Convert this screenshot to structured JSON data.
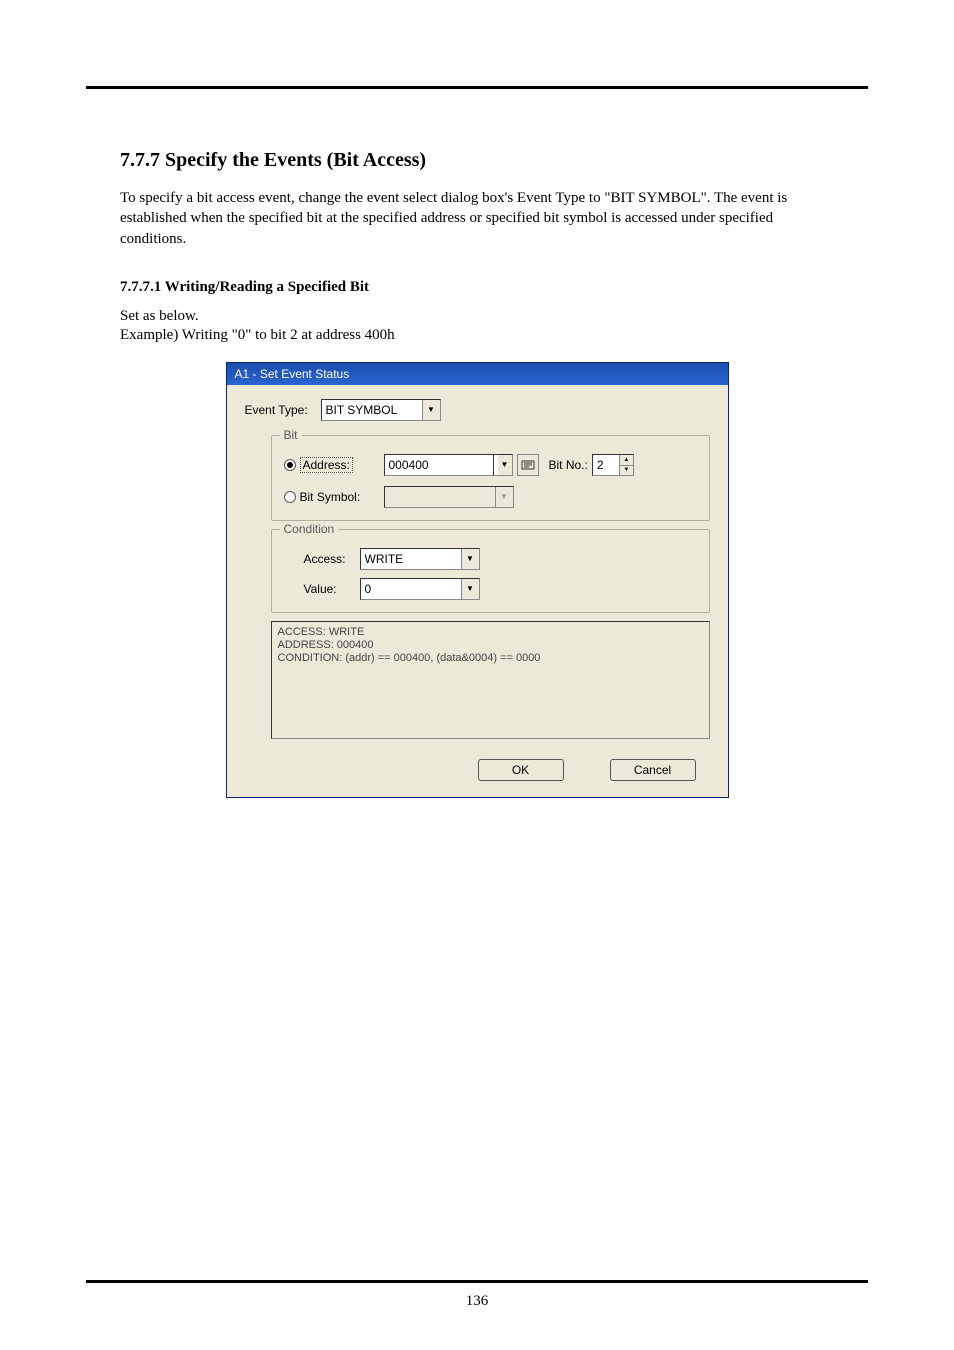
{
  "heading": "7.7.7 Specify the Events (Bit Access)",
  "paragraph": "To specify a bit access event, change the event select dialog box's Event Type to \"BIT SYMBOL\". The event is established when the specified bit at the specified address or specified bit symbol is accessed under specified conditions.",
  "subheading": "7.7.7.1 Writing/Reading a Specified Bit",
  "set_below": "Set as below.",
  "example_line": "Example) Writing \"0\" to bit 2 at address 400h",
  "dialog": {
    "title": "A1 - Set Event Status",
    "event_type_label": "Event Type:",
    "event_type_value": "BIT SYMBOL",
    "bit_legend": "Bit",
    "radio_address_label": "Address:",
    "radio_bitsymbol_label": "Bit Symbol:",
    "address_value": "000400",
    "bitno_label": "Bit No.:",
    "bitno_value": "2",
    "condition_legend": "Condition",
    "access_label": "Access:",
    "access_value": "WRITE",
    "value_label": "Value:",
    "value_value": "0",
    "status_line1": "ACCESS: WRITE",
    "status_line2": "ADDRESS: 000400",
    "status_line3": "CONDITION: (addr) == 000400, (data&0004) == 0000",
    "ok_label": "OK",
    "cancel_label": "Cancel"
  },
  "page_number": "136"
}
